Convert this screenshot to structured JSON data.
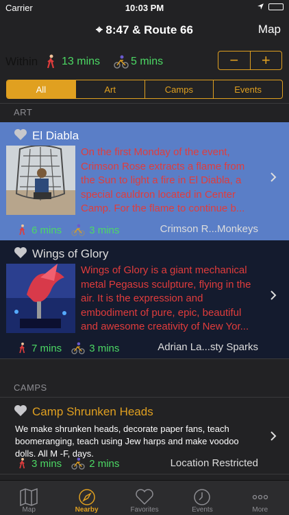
{
  "status": {
    "carrier": "Carrier",
    "time": "10:03 PM"
  },
  "nav": {
    "title": "⌖ 8:47 & Route 66",
    "map_label": "Map"
  },
  "filter": {
    "within_label": "Within",
    "walk_time": "13 mins",
    "bike_time": "5 mins",
    "minus": "−",
    "plus": "+"
  },
  "segments": [
    "All",
    "Art",
    "Camps",
    "Events"
  ],
  "sections": {
    "art": "ART",
    "camps": "CAMPS"
  },
  "art": [
    {
      "title": "El Diabla",
      "description": "On the first Monday of the event, Crimson Rose extracts a flame from the Sun to light a fire in El Diabla, a special cauldron located in Center Camp. For the flame to continue b...",
      "walk": "6 mins",
      "bike": "3 mins",
      "artist": "Crimson R...Monkeys"
    },
    {
      "title": "Wings of Glory",
      "description": "Wings of Glory is a giant mechanical metal Pegasus sculpture, flying in the air. It is the expression and embodiment of pure, epic, beautiful and awesome creativity of New Yor...",
      "walk": "7 mins",
      "bike": "3 mins",
      "artist": "Adrian La...sty Sparks"
    }
  ],
  "camp": {
    "title": "Camp Shrunken Heads",
    "description": "We make shrunken heads, decorate paper fans, teach boomeranging, teach using Jew harps and make voodoo dolls. All M -F, days.",
    "walk": "3 mins",
    "bike": "2 mins",
    "location": "Location Restricted"
  },
  "tabs": [
    "Map",
    "Nearby",
    "Favorites",
    "Events",
    "More"
  ],
  "colors": {
    "accent": "#e0a020",
    "highlight": "#5a7ec7",
    "green": "#4cd964",
    "red": "#e03c3c"
  }
}
